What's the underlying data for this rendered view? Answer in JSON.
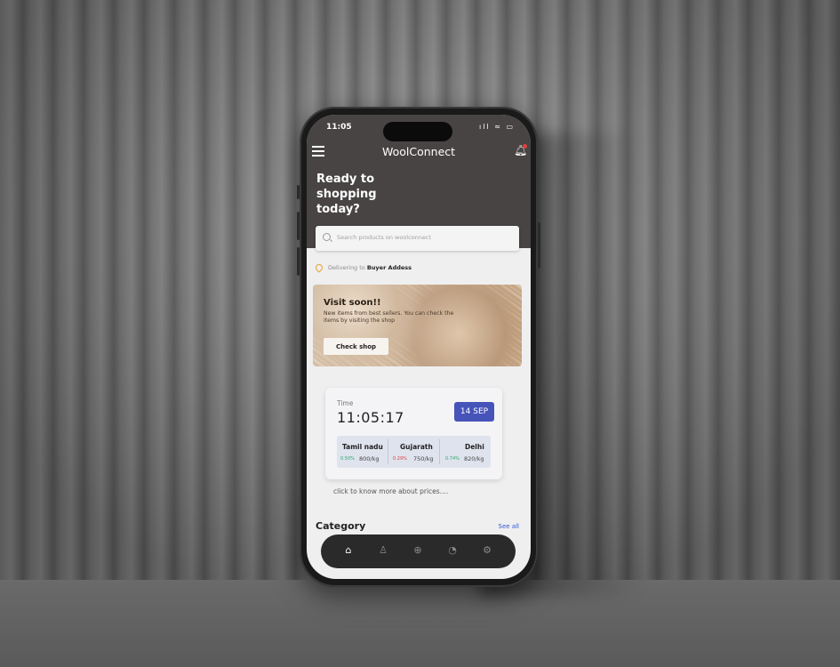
{
  "status": {
    "time": "11:05",
    "icons": "ıll ≈ ▭"
  },
  "header": {
    "title": "WoolConnect"
  },
  "hero": {
    "heading": "Ready to shopping today?"
  },
  "search": {
    "placeholder": "Search products on woolconnect"
  },
  "delivery": {
    "prefix": "Delivering to ",
    "address": "Buyer Addess"
  },
  "banner": {
    "title": "Visit soon!!",
    "subtitle": "New items from best sellers. You can check the items by visiting the shop",
    "button": "Check shop"
  },
  "time_card": {
    "label": "Time",
    "time": "11:05:17",
    "date": "14 SEP",
    "prices": [
      {
        "region": "Tamil nadu",
        "change": "0.50%",
        "change_color": "#2aa868",
        "price": "800/kg"
      },
      {
        "region": "Gujarath",
        "change": "0.29%",
        "change_color": "#e03a3a",
        "price": "750/kg"
      },
      {
        "region": "Delhi",
        "change": "0.74%",
        "change_color": "#2aa868",
        "price": "820/kg"
      }
    ]
  },
  "prices_link": "click to know more about prices....",
  "category": {
    "title": "Category",
    "see_all": "See all"
  },
  "nav": {
    "items": [
      "home-icon",
      "user-icon",
      "add-icon",
      "chart-icon",
      "settings-icon"
    ],
    "active": "home-icon"
  }
}
